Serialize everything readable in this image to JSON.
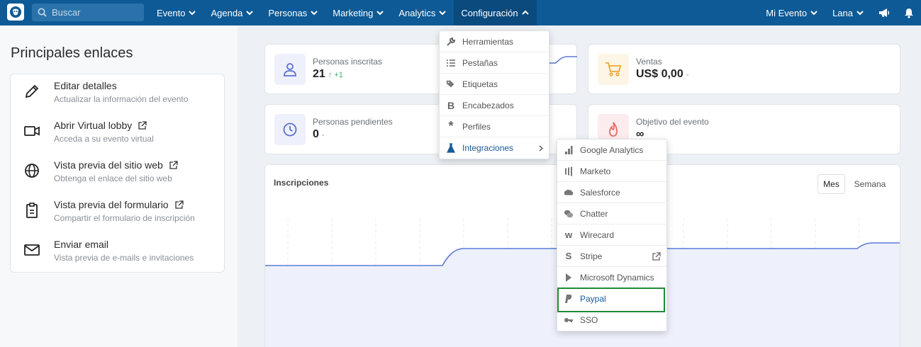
{
  "search": {
    "placeholder": "Buscar"
  },
  "nav": {
    "items": [
      "Evento",
      "Agenda",
      "Personas",
      "Marketing",
      "Analytics",
      "Configuración"
    ],
    "right": [
      "Mi Evento",
      "Lana"
    ]
  },
  "left_panel": {
    "title": "Principales enlaces",
    "links": [
      {
        "title": "Editar detalles",
        "subtitle": "Actualizar la información del evento"
      },
      {
        "title": "Abrir Virtual lobby",
        "subtitle": "Acceda a su evento virtual"
      },
      {
        "title": "Vista previa del sitio web",
        "subtitle": "Obtenga el enlace del sitio web"
      },
      {
        "title": "Vista previa del formulario",
        "subtitle": "Compartir el formulario de inscripción"
      },
      {
        "title": "Enviar email",
        "subtitle": "Vista previa de e-mails e invitaciones"
      }
    ]
  },
  "stats": {
    "inscritas": {
      "label": "Personas inscritas",
      "value": "21",
      "delta": "↑ +1"
    },
    "ventas": {
      "label": "Ventas",
      "value": "US$ 0,00",
      "delta": "-"
    },
    "pendientes": {
      "label": "Personas pendientes",
      "value": "0",
      "delta": "-"
    },
    "objetivo": {
      "label": "Objetivo del evento",
      "value": "∞"
    }
  },
  "chart": {
    "title": "Inscripciones",
    "tab_mes": "Mes",
    "tab_semana": "Semana"
  },
  "config_menu": [
    "Herramientas",
    "Pestañas",
    "Etiquetas",
    "Encabezados",
    "Perfiles",
    "Integraciones"
  ],
  "integrations_menu": [
    "Google Analytics",
    "Marketo",
    "Salesforce",
    "Chatter",
    "Wirecard",
    "Stripe",
    "Microsoft Dynamics",
    "Paypal",
    "SSO"
  ],
  "colors": {
    "topbar": "#0d5a96",
    "accent": "#4a6fd8",
    "positive": "#3cb371",
    "highlight_border": "#1f8a3a"
  }
}
